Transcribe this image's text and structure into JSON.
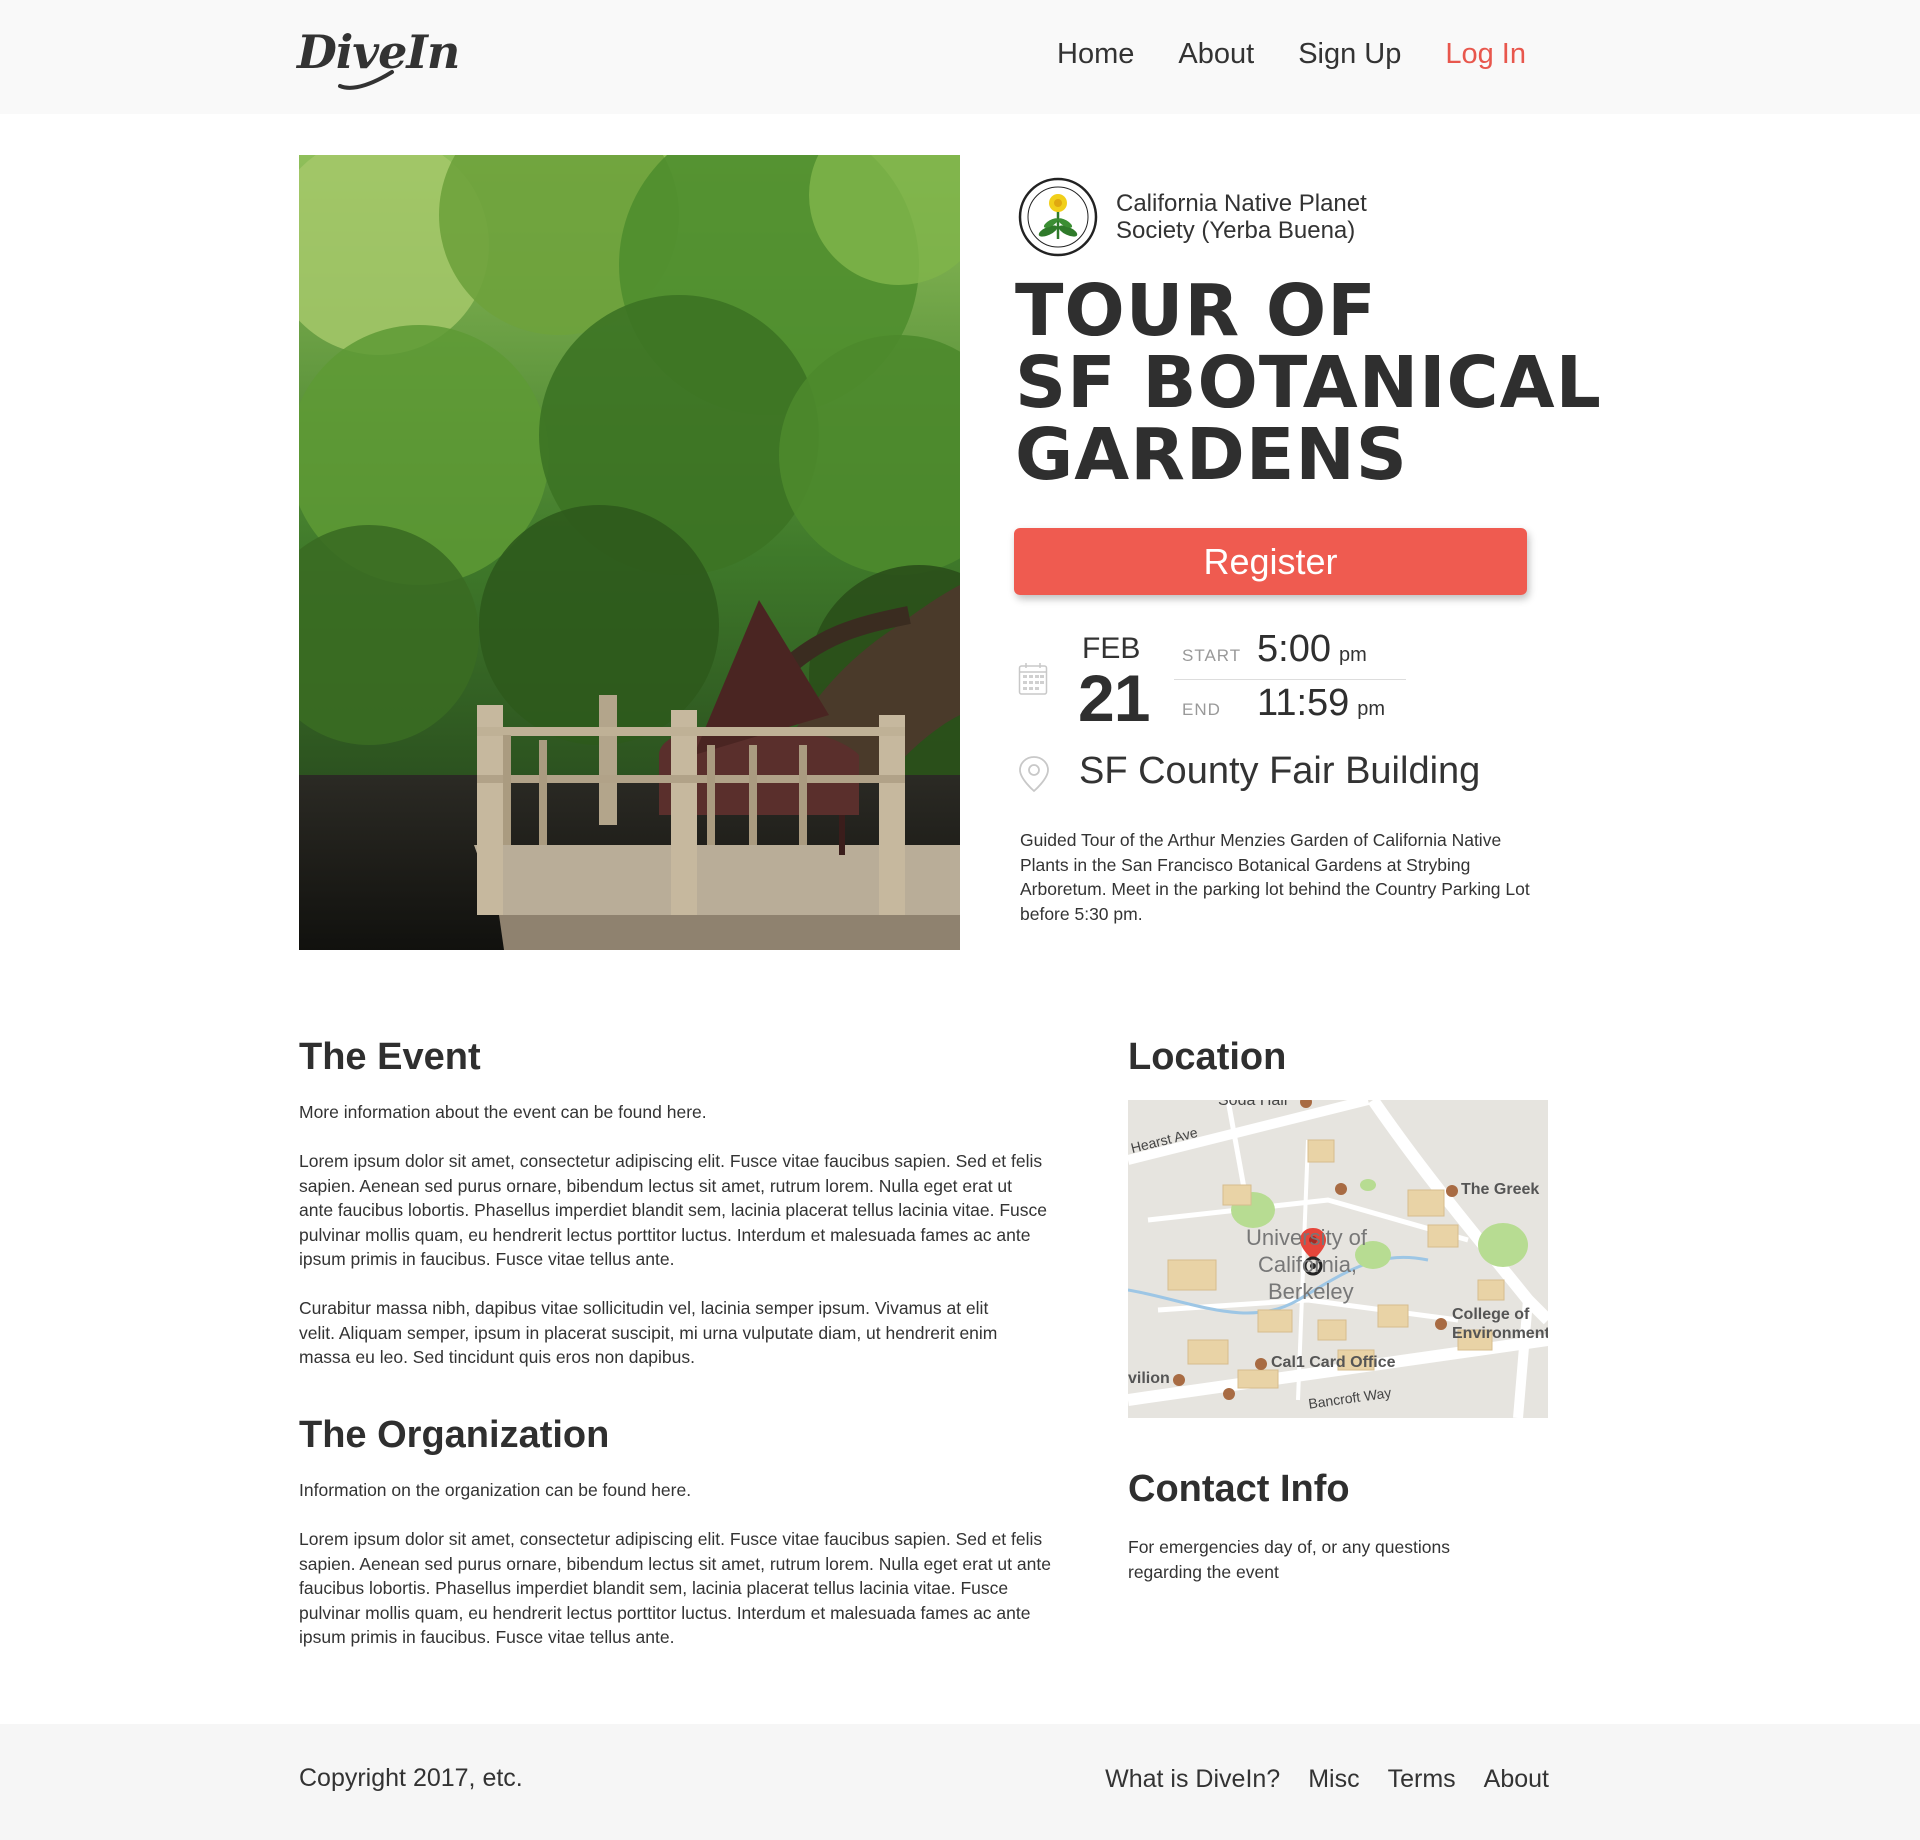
{
  "header": {
    "logo_text": "DiveIn",
    "nav": [
      {
        "label": "Home"
      },
      {
        "label": "About"
      },
      {
        "label": "Sign Up"
      },
      {
        "label": "Log In"
      }
    ]
  },
  "event": {
    "organization": "California Native Planet Society (Yerba Buena)",
    "title_lines": [
      "TOUR OF",
      "SF BOTANICAL",
      "GARDENS"
    ],
    "register_label": "Register",
    "date": {
      "month": "FEB",
      "day": "21"
    },
    "start": {
      "label": "START",
      "time": "5:00",
      "ampm": "pm"
    },
    "end": {
      "label": "END",
      "time": "11:59",
      "ampm": "pm"
    },
    "venue": "SF County Fair Building",
    "description": "Guided Tour of the Arthur Menzies Garden of California Native Plants in the San Francisco Botanical Gardens at Strybing Arboretum. Meet in the parking lot behind the Country Parking Lot before 5:30 pm."
  },
  "the_event": {
    "heading": "The Event",
    "intro": "More information about the event can be found here.",
    "p1": "Lorem ipsum dolor sit amet, consectetur adipiscing elit. Fusce vitae faucibus sapien. Sed et felis sapien. Aenean sed purus ornare, bibendum lectus sit amet, rutrum lorem. Nulla eget erat ut ante faucibus lobortis. Phasellus imperdiet blandit sem, lacinia placerat tellus lacinia vitae. Fusce pulvinar mollis quam, eu hendrerit lectus porttitor luctus. Interdum et malesuada fames ac ante ipsum primis in faucibus. Fusce vitae tellus ante.",
    "p2": "Curabitur massa nibh, dapibus vitae sollicitudin vel, lacinia semper ipsum. Vivamus at elit velit. Aliquam semper, ipsum in placerat suscipit, mi urna vulputate diam, ut hendrerit enim massa eu leo. Sed tincidunt quis eros non dapibus."
  },
  "the_organization": {
    "heading": "The Organization",
    "intro": "Information on the organization can be found here.",
    "p1": "Lorem ipsum dolor sit amet, consectetur adipiscing elit. Fusce vitae faucibus sapien. Sed et felis sapien. Aenean sed purus ornare, bibendum lectus sit amet, rutrum lorem. Nulla eget erat ut ante faucibus lobortis. Phasellus imperdiet blandit sem, lacinia placerat tellus lacinia vitae. Fusce pulvinar mollis quam, eu hendrerit lectus porttitor luctus. Interdum et malesuada fames ac ante ipsum primis in faucibus. Fusce vitae tellus ante."
  },
  "location": {
    "heading": "Location",
    "map_labels": {
      "soda_hall": "Soda Hall",
      "hearst_ave": "Hearst Ave",
      "the_greek": "The Greek",
      "university_line1": "University of",
      "university_line2": "California,",
      "university_line3": "Berkeley",
      "college_line1": "College of",
      "college_line2": "Environment",
      "cal1": "Cal1 Card Office",
      "pavilion": "vilion",
      "bancroft": "Bancroft Way"
    }
  },
  "contact": {
    "heading": "Contact Info",
    "text": "For emergencies day of, or any questions regarding the event"
  },
  "footer": {
    "copyright": "Copyright 2017, etc.",
    "links": [
      {
        "label": "What is DiveIn?"
      },
      {
        "label": "Misc"
      },
      {
        "label": "Terms"
      },
      {
        "label": "About"
      }
    ]
  },
  "colors": {
    "accent": "#ef5b50",
    "login_link": "#e8574d",
    "text": "#333333",
    "header_bg": "#f9f9f9",
    "footer_bg": "#f6f6f6"
  }
}
